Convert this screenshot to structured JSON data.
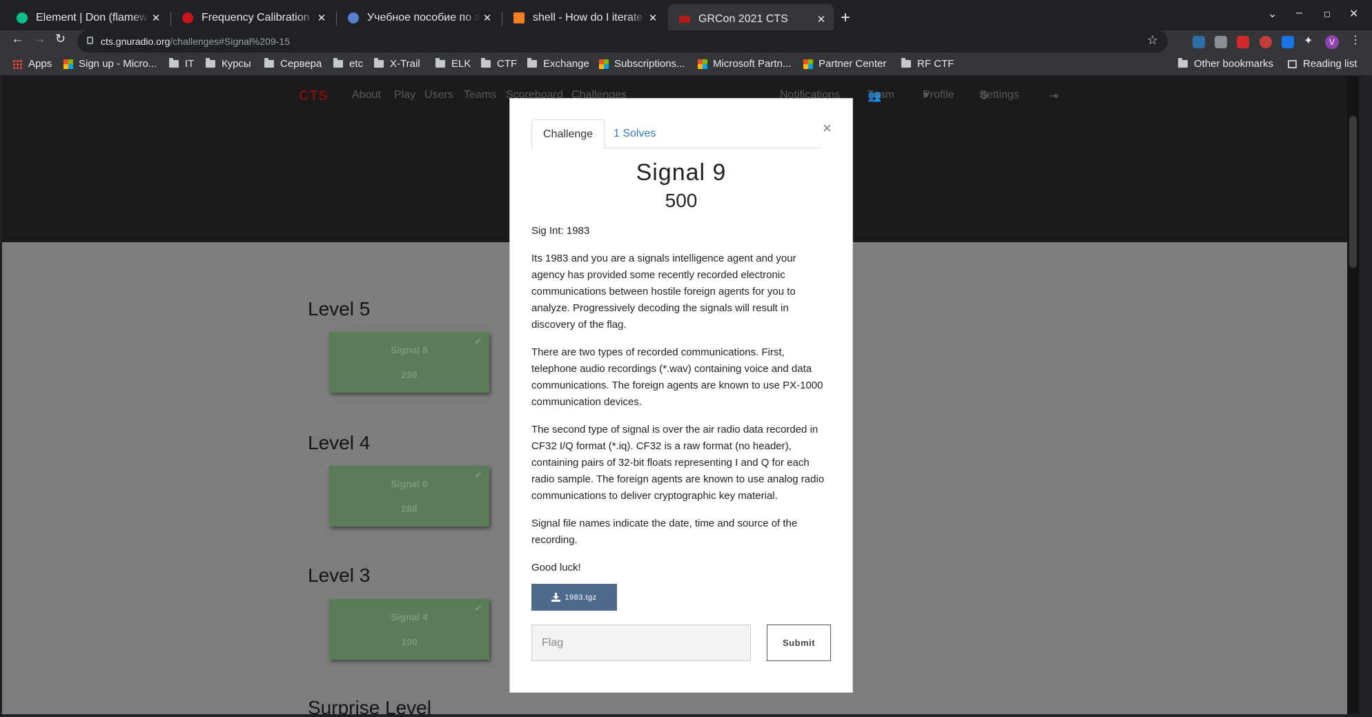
{
  "browser": {
    "tabs": [
      {
        "title": "Element | Don (flamewire",
        "fav_color": "#0dbd8b"
      },
      {
        "title": "Frequency Calibration for",
        "fav_color": "#c4161c"
      },
      {
        "title": "Учебное пособие по экспе",
        "fav_color": "#5b7fcf"
      },
      {
        "title": "shell - How do I iterate ove",
        "fav_color": "#f48024"
      },
      {
        "title": "GRCon 2021 CTS",
        "fav_color": "#b31b1b"
      }
    ],
    "url_host": "cts.gnuradio.org",
    "url_path": "/challenges#Signal%209-15",
    "profile_initial": "V",
    "bookmarks": [
      "Apps",
      "Sign up - Micro...",
      "IT",
      "Курсы",
      "Сервера",
      "etc",
      "X-Trail",
      "ELK",
      "CTF",
      "Exchange",
      "Subscriptions...",
      "Microsoft Partn...",
      "Partner Center",
      "RF CTF"
    ],
    "other_bookmarks": "Other bookmarks",
    "reading_list": "Reading list"
  },
  "site": {
    "logo": "CTS",
    "nav": [
      "About",
      "Play",
      "Users",
      "Teams",
      "Scoreboard",
      "Challenges"
    ],
    "nav_right": [
      "Notifications",
      "Team",
      "Profile",
      "Settings"
    ]
  },
  "levels": [
    {
      "title": "Level 5",
      "card": {
        "name": "Signal 8",
        "points": "299"
      }
    },
    {
      "title": "Level 4",
      "card": {
        "name": "Signal 6",
        "points": "288"
      }
    },
    {
      "title": "Level 3",
      "card": {
        "name": "Signal 4",
        "points": "100"
      }
    },
    {
      "title": "Surprise Level"
    }
  ],
  "modal": {
    "tab_challenge": "Challenge",
    "tab_solves": "1 Solves",
    "close": "×",
    "title": "Signal 9",
    "points": "500",
    "category": "Sig Int: 1983",
    "paragraphs": [
      "Its 1983 and you are a signals intelligence agent and your agency has provided some recently recorded electronic communications between hostile foreign agents for you to analyze. Progressively decoding the signals will result in discovery of the flag.",
      "There are two types of recorded communications. First, telephone audio recordings (*.wav) containing voice and data communications. The foreign agents are known to use PX-1000 communication devices.",
      "The second type of signal is over the air radio data recorded in CF32 I/Q format (*.iq). CF32 is a raw format (no header), containing pairs of 32-bit floats representing I and Q for each radio sample. The foreign agents are known to use analog radio communications to deliver cryptographic key material.",
      "Signal file names indicate the date, time and source of the recording.",
      "Good luck!"
    ],
    "file_label": "1983.tgz",
    "flag_placeholder": "Flag",
    "submit_label": "Submit"
  }
}
